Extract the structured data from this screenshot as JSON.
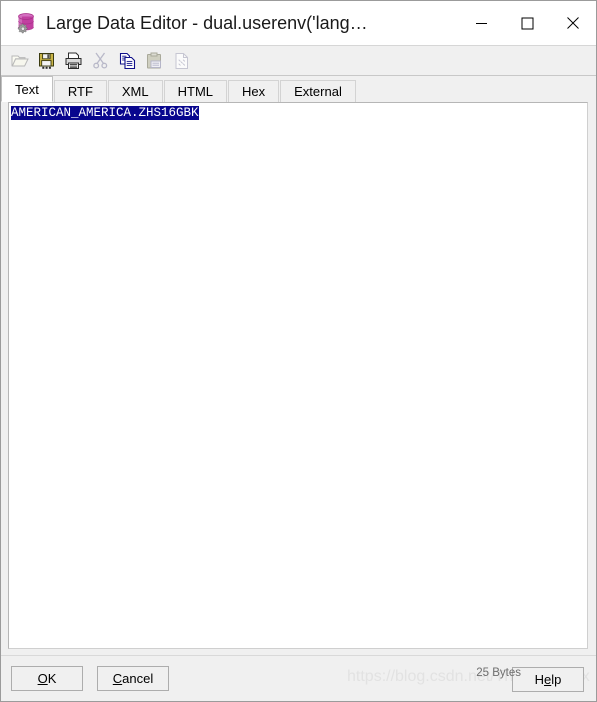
{
  "window": {
    "title": "Large Data Editor - dual.userenv('lang…",
    "icon": "database-gear-icon",
    "controls": {
      "minimize": "minimize-icon",
      "maximize": "maximize-icon",
      "close": "close-icon"
    }
  },
  "toolbar": {
    "buttons": [
      {
        "name": "open-button",
        "icon": "folder-open-icon",
        "enabled": false
      },
      {
        "name": "save-button",
        "icon": "floppy-save-icon",
        "enabled": true
      },
      {
        "name": "print-button",
        "icon": "printer-icon",
        "enabled": true
      },
      {
        "name": "cut-button",
        "icon": "scissors-icon",
        "enabled": false
      },
      {
        "name": "copy-button",
        "icon": "copy-icon",
        "enabled": true
      },
      {
        "name": "paste-button",
        "icon": "clipboard-paste-icon",
        "enabled": false
      },
      {
        "name": "clear-button",
        "icon": "document-clear-icon",
        "enabled": false
      }
    ]
  },
  "tabs": [
    {
      "label": "Text",
      "active": true
    },
    {
      "label": "RTF",
      "active": false
    },
    {
      "label": "XML",
      "active": false
    },
    {
      "label": "HTML",
      "active": false
    },
    {
      "label": "Hex",
      "active": false
    },
    {
      "label": "External",
      "active": false
    }
  ],
  "editor": {
    "content": "AMERICAN_AMERICA.ZHS16GBK",
    "selected": true,
    "selection_color": "#08068e",
    "selection_text_color": "#ffffff"
  },
  "footer": {
    "ok_label": "OK",
    "cancel_label": "Cancel",
    "help_label": "Help",
    "bytes_label": "25 Bytes"
  },
  "watermark": {
    "text": "https://blog.csdn.net/TheWhiteFox"
  }
}
